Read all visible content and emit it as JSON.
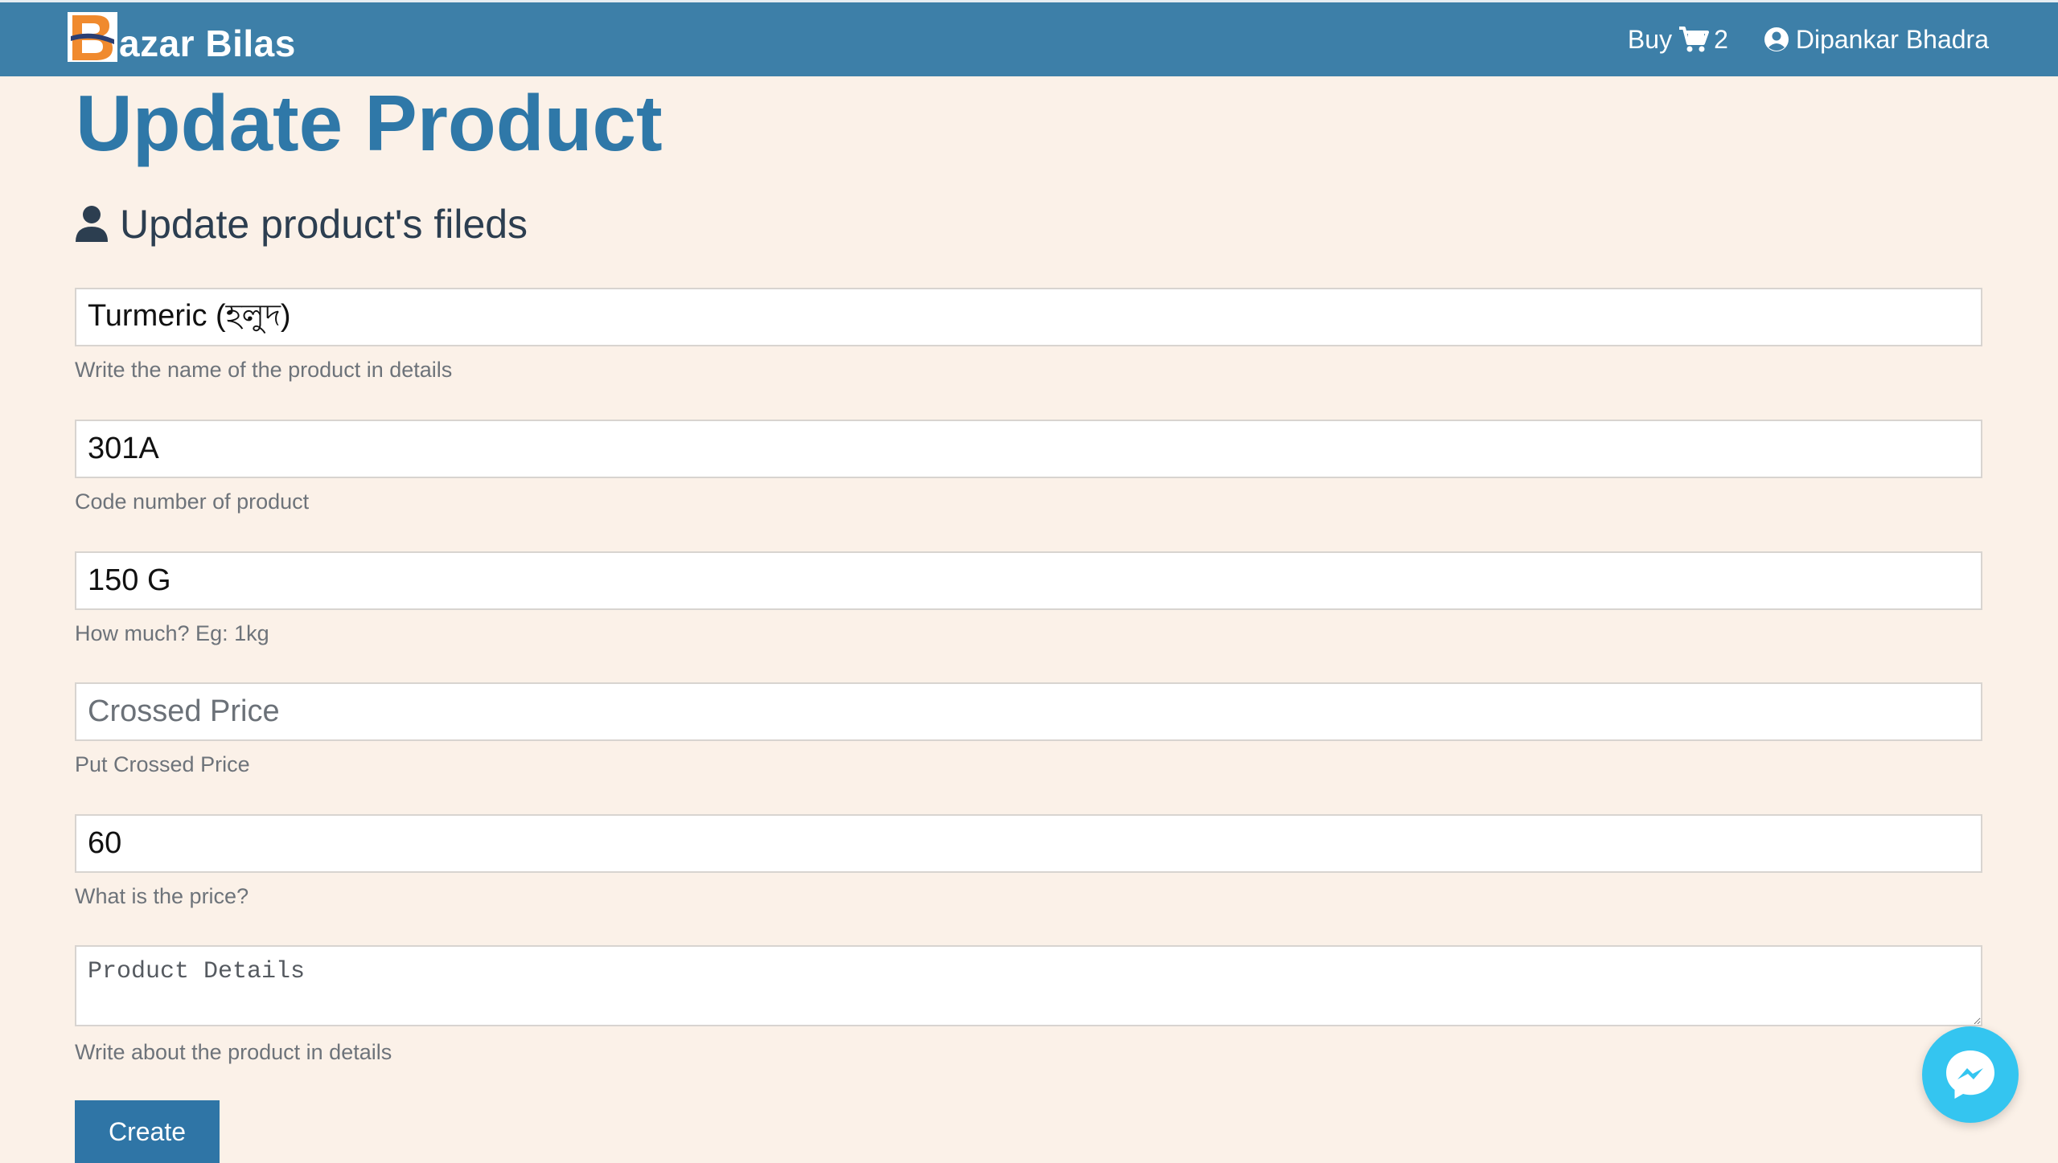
{
  "navbar": {
    "brand_text": "azar Bilas",
    "logo_letter": "B",
    "buy_label": "Buy",
    "cart_count": "2",
    "user_name": "Dipankar Bhadra",
    "background_color": "#3d7fa8"
  },
  "page": {
    "title": "Update Product",
    "section_title": "Update product's fileds",
    "title_color": "#2f78a8"
  },
  "form": {
    "name": {
      "value": "Turmeric (হলুদ)",
      "placeholder": "",
      "help": "Write the name of the product in details"
    },
    "code": {
      "value": "301A",
      "placeholder": "",
      "help": "Code number of product"
    },
    "quantity": {
      "value": "150 G",
      "placeholder": "",
      "help": "How much? Eg: 1kg"
    },
    "crossed_price": {
      "value": "",
      "placeholder": "Crossed Price",
      "help": "Put Crossed Price"
    },
    "price": {
      "value": "60",
      "placeholder": "",
      "help": "What is the price?"
    },
    "details": {
      "value": "",
      "placeholder": "Product Details",
      "help": "Write about the product in details"
    },
    "submit_label": "Create"
  },
  "icons": {
    "logo": "bazar-bilas-logo-icon",
    "cart": "cart-icon",
    "user": "user-circle-icon",
    "section": "user-icon",
    "messenger": "messenger-icon"
  }
}
